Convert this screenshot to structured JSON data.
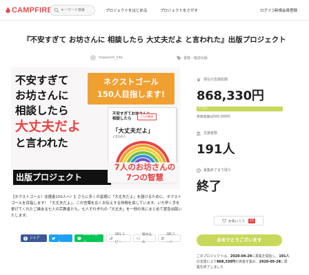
{
  "header": {
    "logo": "CAMPFIRE",
    "search_placeholder": "キーワード検索",
    "nav_start": "プロジェクトをはじめる",
    "nav_find": "プロジェクトをさがす",
    "login": "ログイン",
    "signup": "新規会員登録"
  },
  "project": {
    "title": "『不安すぎて お坊さんに 相談したら 大丈夫だよ と言われた』出版プロジェクト",
    "owner": "masanori_iida",
    "category": "書籍・雑誌出版"
  },
  "hero": {
    "line1": "不安すぎて",
    "line2": "お坊さんに",
    "line3": "相談したら",
    "line4": "大丈夫だよ",
    "line5": "と言われた",
    "bar": "出版プロジェクト",
    "goal_line1": "ネクストゴール",
    "goal_line2": "150人目指します!",
    "book_title": "不安すぎてお坊さんに相談したら",
    "book_big": "「大丈夫だよ」",
    "book_sub": "と言われた",
    "book_sticker": "7人の僧侶",
    "wisdom_line1": "7人のお坊さんの",
    "wisdom_line2": "7つの智慧"
  },
  "description": "【ネクストゴール！支援者150人へ！】さらに多くの皆様に「大丈夫だよ」を届けるために、ネクストゴールを目指します！「大丈夫だよ」。この言葉を広くお伝えする仲間を探しています。いち早く手を挙げてくれたご縁ある七人の宗教者たち。七人それぞれの「大丈夫」を一冊の本にまとめて緊急出版いたします。",
  "share": {
    "facebook": "シェア",
    "twitter": "ツイート",
    "line": "LINEで送る",
    "url": "URLコピー",
    "embed": "埋め込み",
    "qr": "QRコード"
  },
  "stats": {
    "amount_label": "現在の支援総額",
    "amount": "868,330円",
    "progress_percent": 173,
    "progress_label": "173%",
    "goal_text": "目標金額は500,000円",
    "supporters_label": "支援者数",
    "supporters": "191人",
    "remaining_label": "募集終了まで残り",
    "remaining": "終了",
    "favorite_label": "お気に入り",
    "favorite_count": "16",
    "thanks_button": "おめでとうございます",
    "note_prefix": "このプロジェクトは、",
    "note_start": "2020-04-29",
    "note_mid1": "に募集を開始し、",
    "note_count": "191人",
    "note_mid2": "の支援により",
    "note_amount": "868,330円",
    "note_mid3": "の資金を集め、",
    "note_end": "2020-05-28",
    "note_suffix": "に募集を終了しました"
  },
  "colors": {
    "brand": "#e94a4a",
    "accent_green": "#c8d85a",
    "goal_orange": "#f0a030"
  }
}
